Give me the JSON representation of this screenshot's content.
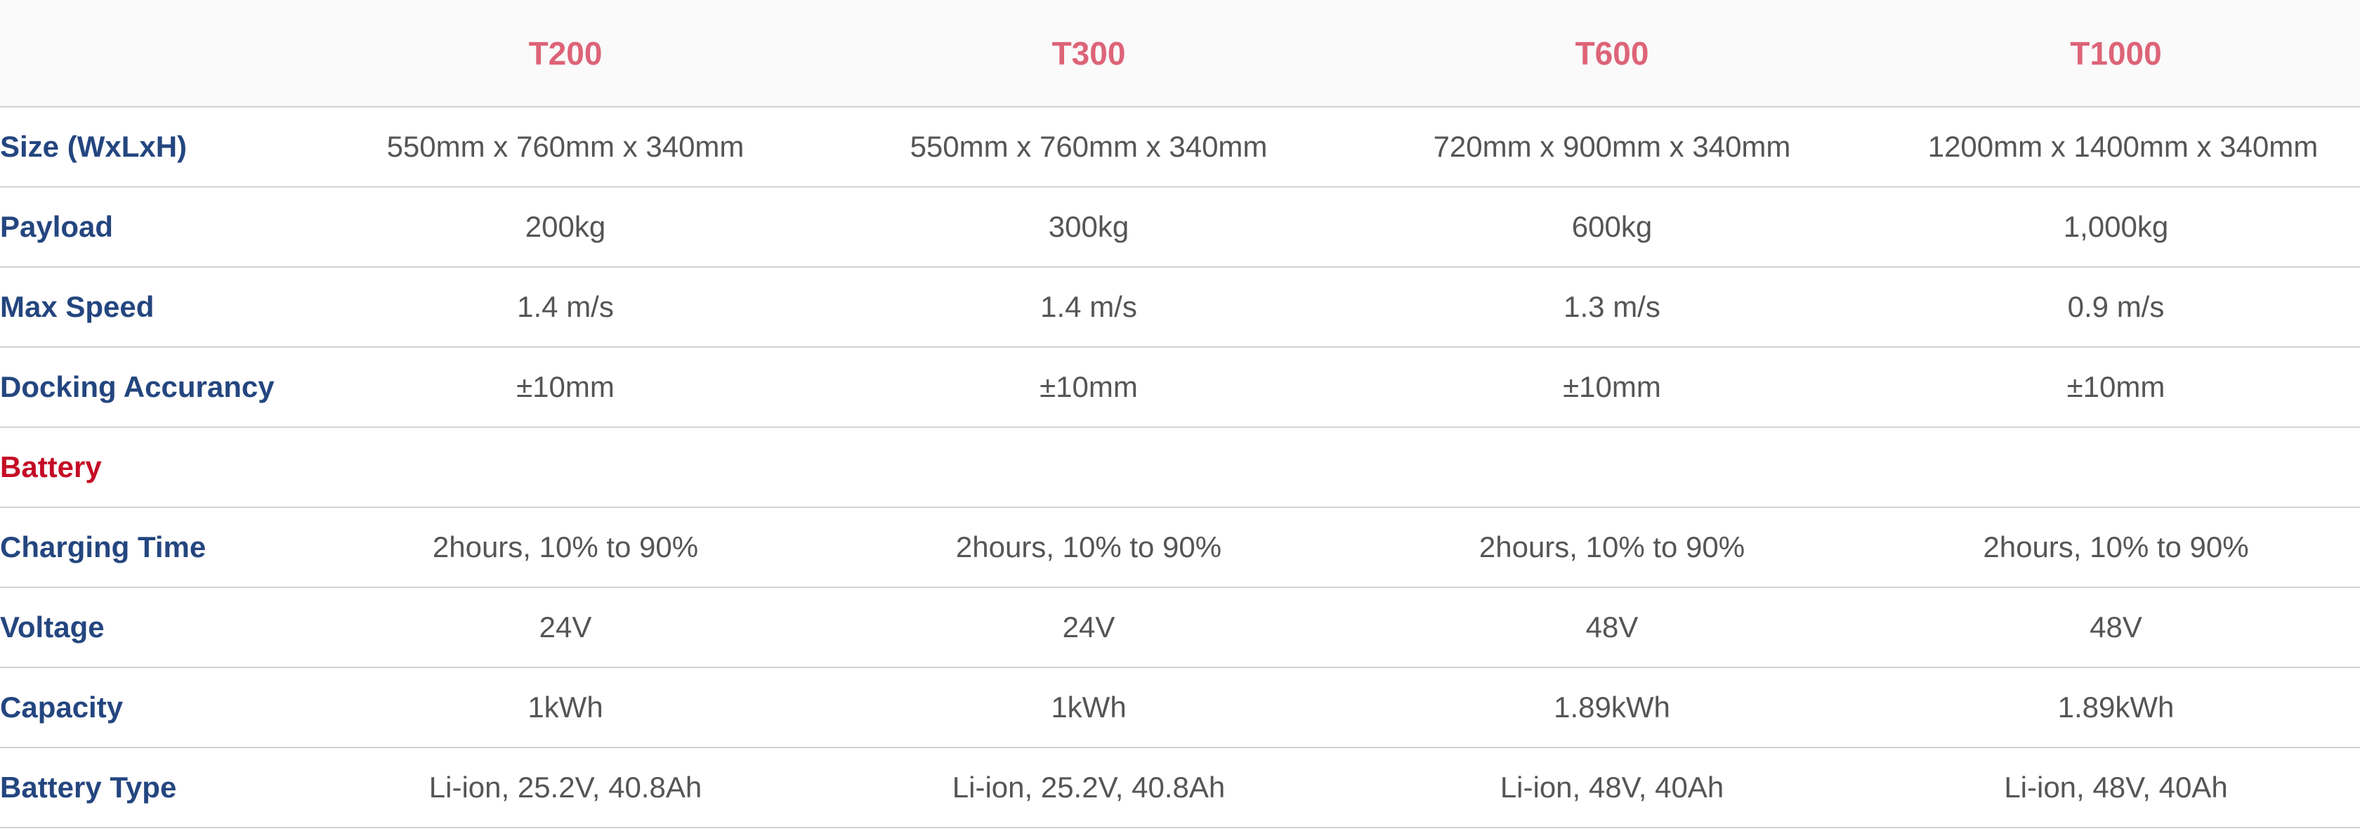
{
  "table": {
    "columns": [
      "T200",
      "T300",
      "T600",
      "T1000"
    ],
    "rows": [
      {
        "label": "Size (WxLxH)",
        "values": [
          "550mm x 760mm x 340mm",
          "550mm x 760mm x 340mm",
          "720mm x 900mm x 340mm",
          "1200mm x 1400mm x 340mm"
        ]
      },
      {
        "label": "Payload",
        "values": [
          "200kg",
          "300kg",
          "600kg",
          "1,000kg"
        ]
      },
      {
        "label": "Max Speed",
        "values": [
          "1.4 m/s",
          "1.4 m/s",
          "1.3 m/s",
          "0.9 m/s"
        ]
      },
      {
        "label": "Docking Accurancy",
        "values": [
          "±10mm",
          "±10mm",
          "±10mm",
          "±10mm"
        ]
      },
      {
        "label": "Battery",
        "section": true
      },
      {
        "label": "Charging Time",
        "values": [
          "2hours, 10% to 90%",
          "2hours, 10% to 90%",
          "2hours, 10% to 90%",
          "2hours, 10% to 90%"
        ]
      },
      {
        "label": "Voltage",
        "values": [
          "24V",
          "24V",
          "48V",
          "48V"
        ]
      },
      {
        "label": "Capacity",
        "values": [
          "1kWh",
          "1kWh",
          "1.89kWh",
          "1.89kWh"
        ]
      },
      {
        "label": "Battery Type",
        "values": [
          "Li-ion, 25.2V, 40.8Ah",
          "Li-ion, 25.2V, 40.8Ah",
          "Li-ion, 48V, 40Ah",
          "Li-ion, 48V, 40Ah"
        ]
      }
    ]
  },
  "colors": {
    "model_header": "#dd6478",
    "row_label": "#24467f",
    "section_label": "#c40c25",
    "cell_text": "#555555",
    "divider": "#d2d2d2",
    "header_background": "#fafafa"
  }
}
